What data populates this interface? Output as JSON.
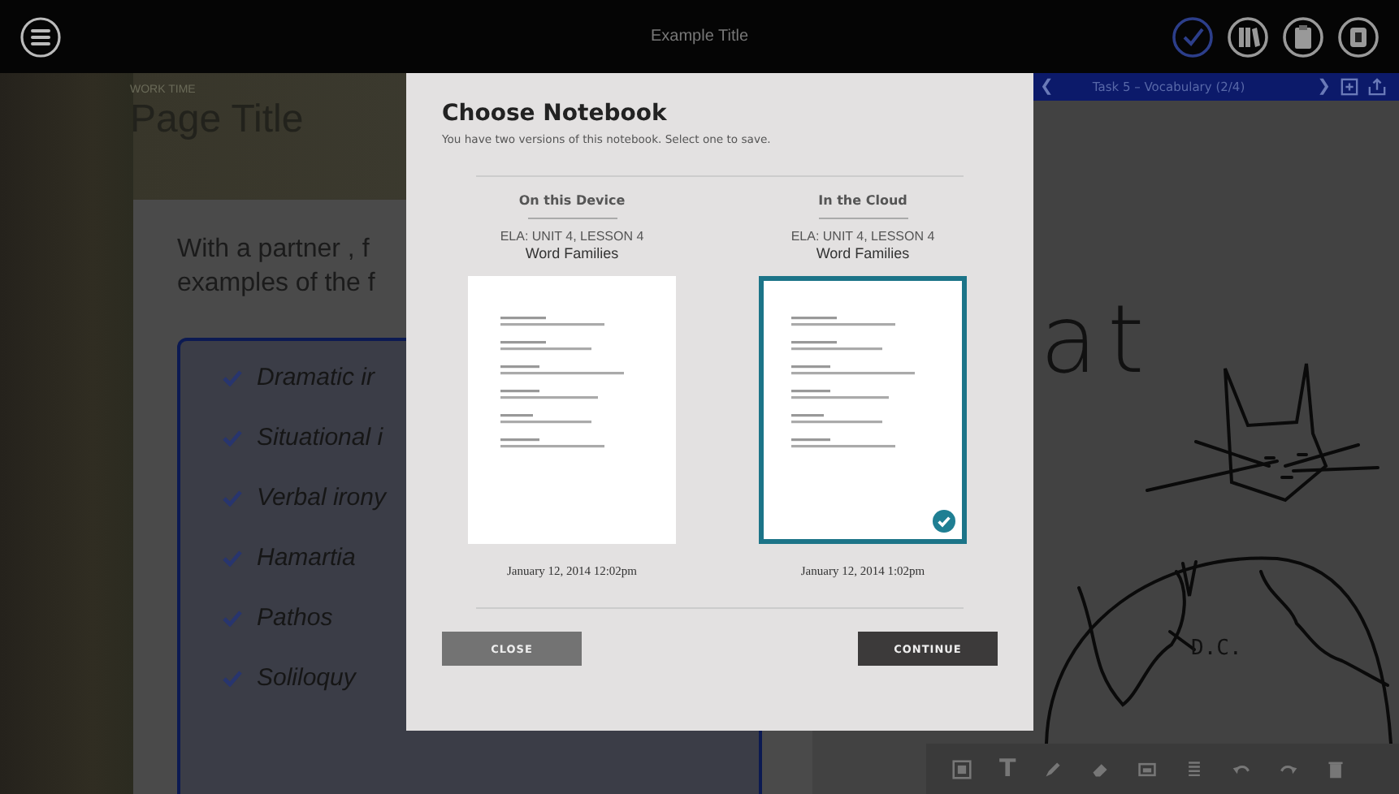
{
  "top_bar": {
    "title": "Example Title"
  },
  "header": {
    "section": "WORK TIME",
    "title": "Page Title"
  },
  "lesson": {
    "prompt_lines": [
      "With a partner , f",
      "examples of the f"
    ],
    "terms": [
      "Dramatic ir",
      "Situational i",
      "Verbal irony",
      "Hamartia",
      "Pathos",
      "Soliloquy"
    ]
  },
  "task_bar": {
    "prev": "❮",
    "label": "Task 5 – Vocabulary (2/4)",
    "next": "❯"
  },
  "canvas": {
    "handwriting": [
      {
        "kind": "word",
        "text": "at"
      },
      {
        "kind": "label",
        "text": "D.C."
      }
    ]
  },
  "toolbar": {
    "text_tool": "T"
  },
  "dialog": {
    "title": "Choose Notebook",
    "subtitle": "You have two versions of this notebook. Select one to save.",
    "versions": [
      {
        "heading": "On this Device",
        "lesson": "ELA: UNIT 4, LESSON 4",
        "name": "Word Families",
        "date": "January 12, 2014 12:02pm",
        "selected": false
      },
      {
        "heading": "In the Cloud",
        "lesson": "ELA: UNIT 4, LESSON 4",
        "name": "Word Families",
        "date": "January 12, 2014 1:02pm",
        "selected": true
      }
    ],
    "buttons": [
      {
        "label": "CLOSE",
        "kind": "secondary"
      },
      {
        "label": "CONTINUE",
        "kind": "primary"
      }
    ]
  }
}
